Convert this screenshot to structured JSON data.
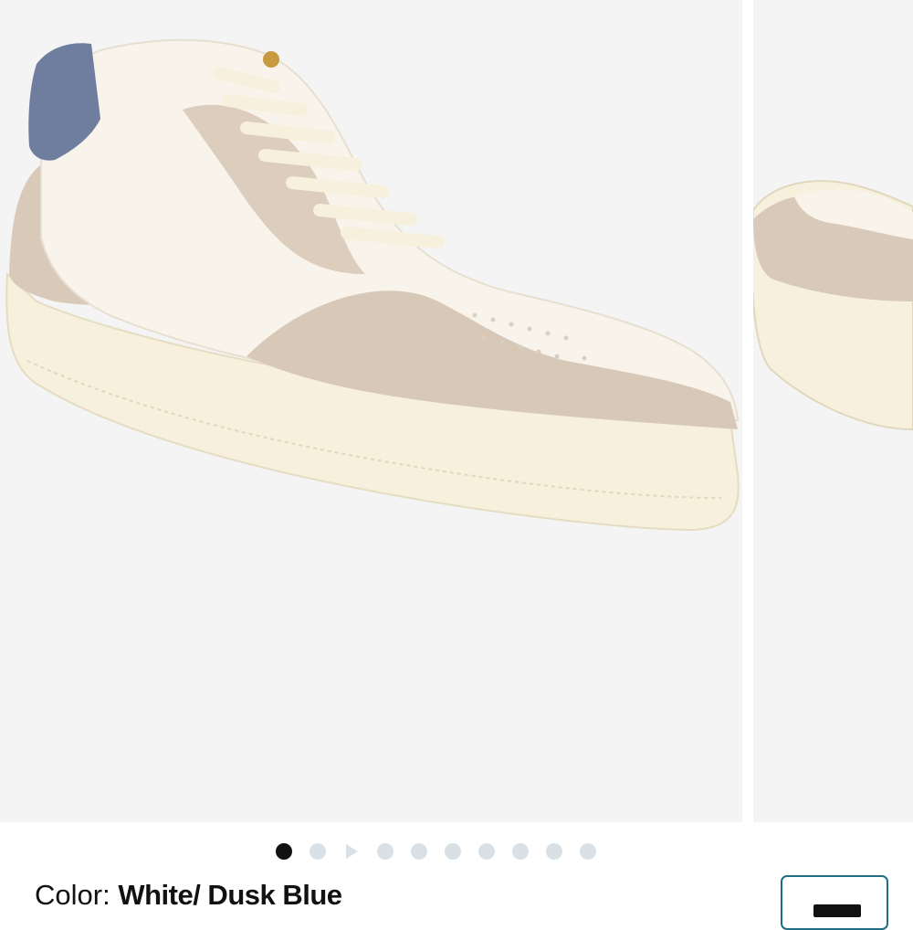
{
  "gallery": {
    "images": [
      {
        "icon": "sneaker-main-image",
        "alt_colors": {
          "upper": "#f7f3ea",
          "suede": "#d8c8b8",
          "heel_tab": "#6e7c9e",
          "sole": "#f5efdc"
        }
      },
      {
        "icon": "sneaker-next-image"
      }
    ],
    "dots": {
      "count": 10,
      "active_index": 0,
      "video_index": 2
    }
  },
  "product": {
    "color_label": "Color:",
    "color_value": "White/ Dusk Blue"
  },
  "colors": {
    "active_dot": "#111111",
    "inactive_dot": "#d9e1e7",
    "selected_swatch_border": "#1f6e84"
  }
}
